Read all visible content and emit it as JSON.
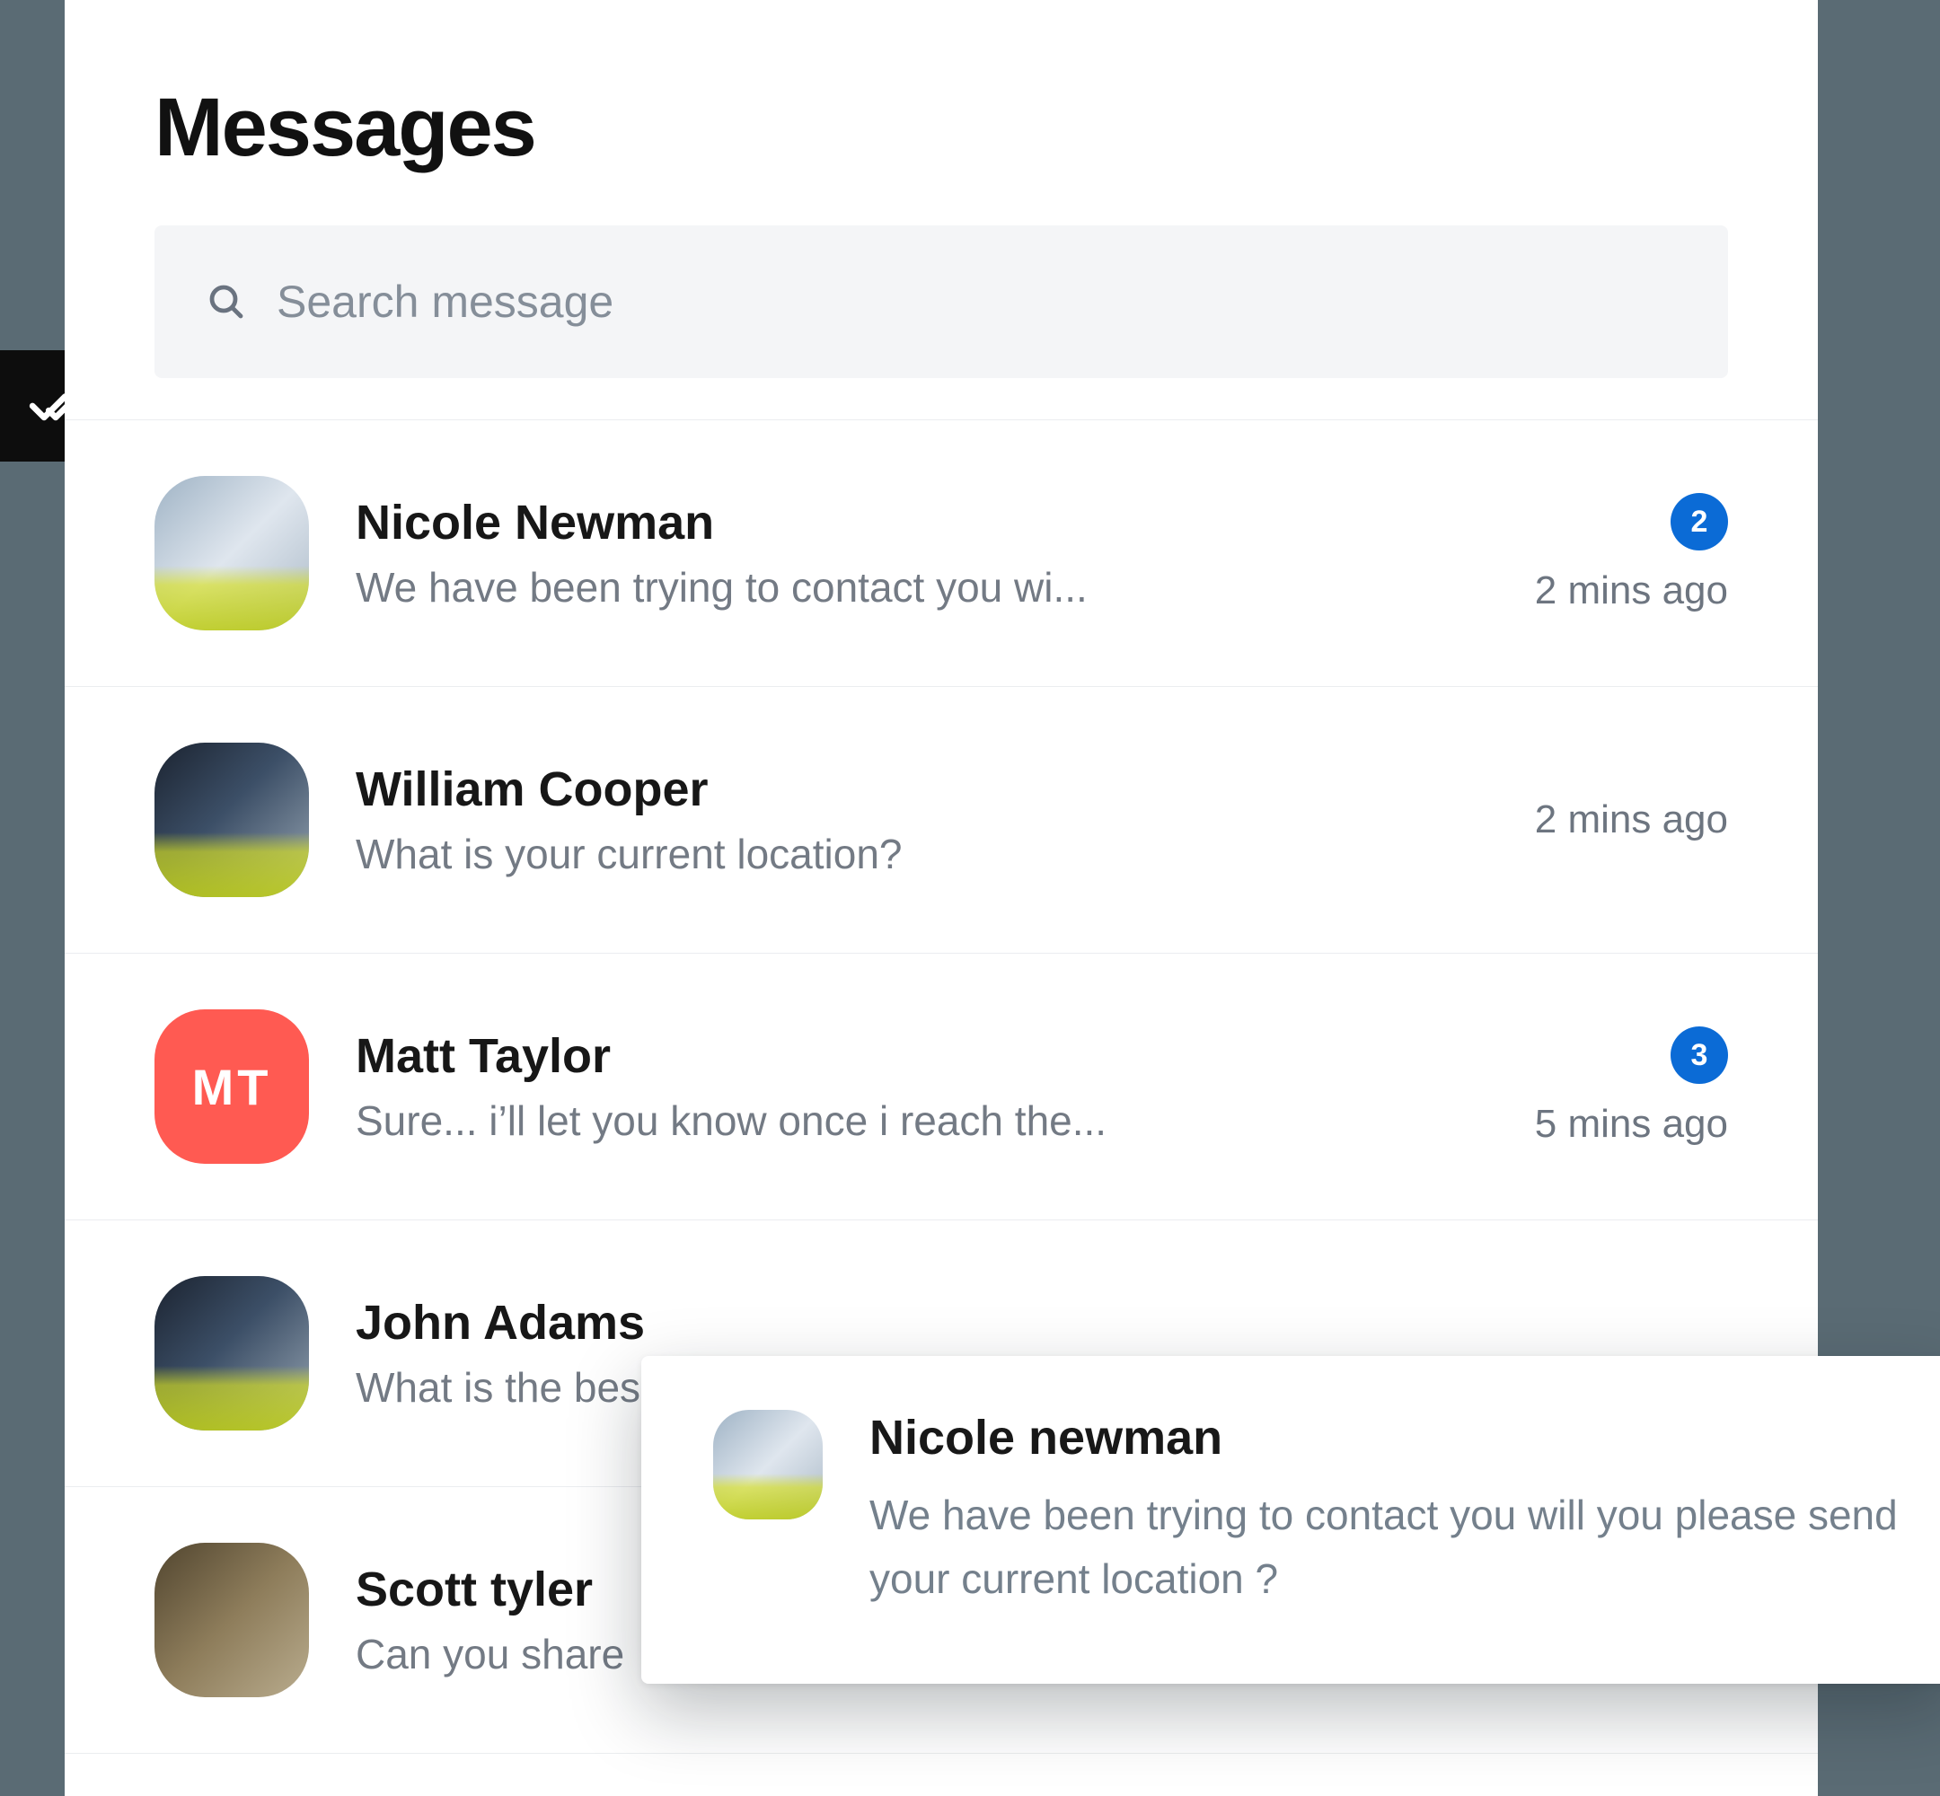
{
  "header": {
    "title": "Messages"
  },
  "search": {
    "placeholder": "Search message"
  },
  "conversations": [
    {
      "name": "Nicole Newman",
      "snippet": "We have been trying to contact you wi...",
      "time": "2 mins ago",
      "unread": "2",
      "avatar_type": "photo-a",
      "initials": ""
    },
    {
      "name": "William Cooper",
      "snippet": "What is your current location?",
      "time": "2 mins ago",
      "unread": "",
      "avatar_type": "photo-b",
      "initials": ""
    },
    {
      "name": "Matt Taylor",
      "snippet": "Sure... i’ll let you know once i reach the...",
      "time": "5 mins ago",
      "unread": "3",
      "avatar_type": "initials",
      "initials": "MT"
    },
    {
      "name": "John Adams",
      "snippet": "What is the bes",
      "time": "",
      "unread": "",
      "avatar_type": "photo-b",
      "initials": ""
    },
    {
      "name": "Scott tyler",
      "snippet": "Can you share",
      "time": "",
      "unread": "",
      "avatar_type": "photo-c",
      "initials": ""
    }
  ],
  "toast": {
    "name": "Nicole newman",
    "message": "We have been trying to contact you will you please send your current location ?"
  },
  "icons": {
    "sidebar": "double-check-icon",
    "search": "search-icon"
  }
}
